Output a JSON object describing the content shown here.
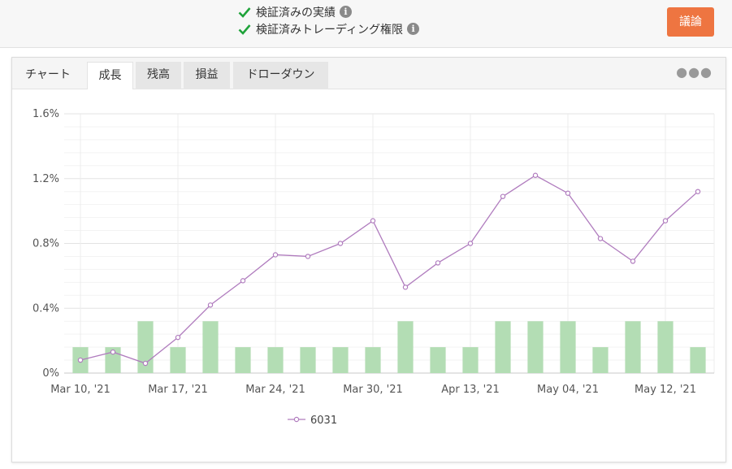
{
  "header": {
    "verified": [
      {
        "label": "検証済みの実績",
        "icon": "check-icon"
      },
      {
        "label": "検証済みトレーディング権限",
        "icon": "check-icon"
      }
    ],
    "discuss_button": "議論"
  },
  "tabs": [
    {
      "label": "チャート",
      "state": "plain"
    },
    {
      "label": "成長",
      "state": "active"
    },
    {
      "label": "残高",
      "state": "inactive"
    },
    {
      "label": "損益",
      "state": "inactive"
    },
    {
      "label": "ドローダウン",
      "state": "inactive"
    }
  ],
  "menu_icon": "more-dots-icon",
  "colors": {
    "accent": "#ee7541",
    "check": "#1fa33a",
    "line": "#b07cbe",
    "bar": "#b3ddb4",
    "grid": "#e8e8e8"
  },
  "chart_data": {
    "type": "bar+line",
    "title": "",
    "xlabel": "",
    "ylabel": "",
    "ylim": [
      0,
      1.6
    ],
    "y_ticks": [
      "0%",
      "0.4%",
      "0.8%",
      "1.2%",
      "1.6%"
    ],
    "y_tick_values": [
      0,
      0.4,
      0.8,
      1.2,
      1.6
    ],
    "x_tick_labels": [
      "Mar 10, '21",
      "Mar 17, '21",
      "Mar 24, '21",
      "Mar 30, '21",
      "Apr 13, '21",
      "May 04, '21",
      "May 12, '21"
    ],
    "x_tick_positions": [
      0,
      3,
      6,
      9,
      12,
      15,
      18
    ],
    "bars": [
      0.16,
      0.16,
      0.32,
      0.16,
      0.32,
      0.16,
      0.16,
      0.16,
      0.16,
      0.16,
      0.32,
      0.16,
      0.16,
      0.32,
      0.32,
      0.32,
      0.16,
      0.32,
      0.32,
      0.16
    ],
    "series": [
      {
        "name": "6031",
        "values": [
          0.08,
          0.13,
          0.06,
          0.22,
          0.42,
          0.57,
          0.73,
          0.72,
          0.8,
          0.94,
          0.53,
          0.68,
          0.8,
          1.09,
          1.22,
          1.11,
          0.83,
          0.69,
          0.94,
          1.12
        ]
      }
    ],
    "legend_position": "bottom-center",
    "grid": true
  }
}
